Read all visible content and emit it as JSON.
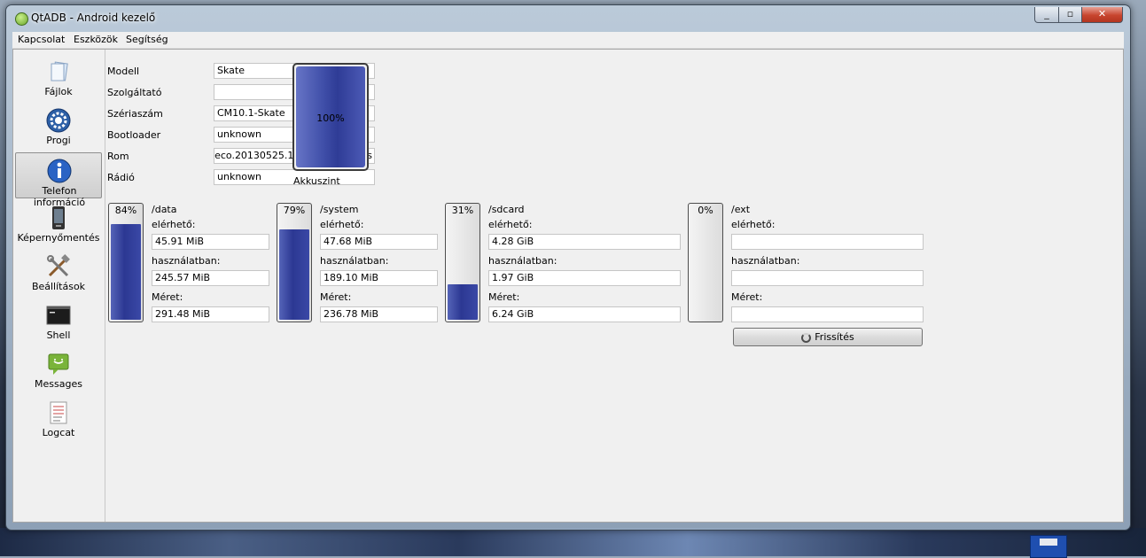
{
  "window": {
    "title": "QtADB - Android kezelő"
  },
  "menu": [
    "Kapcsolat",
    "Eszközök",
    "Segítség"
  ],
  "sidebar": [
    {
      "label": "Fájlok",
      "icon": "files-icon"
    },
    {
      "label": "Progi",
      "icon": "gear-icon"
    },
    {
      "label": "Telefon információ",
      "icon": "info-icon",
      "active": true
    },
    {
      "label": "Képernyőmentés",
      "icon": "phone-icon"
    },
    {
      "label": "Beállítások",
      "icon": "tools-icon"
    },
    {
      "label": "Shell",
      "icon": "terminal-icon"
    },
    {
      "label": "Messages",
      "icon": "message-icon"
    },
    {
      "label": "Logcat",
      "icon": "log-icon"
    }
  ],
  "info": {
    "labels": {
      "model": "Modell",
      "operator": "Szolgáltató",
      "serial": "Szériaszám",
      "bootloader": "Bootloader",
      "rom": "Rom",
      "radio": "Rádió"
    },
    "values": {
      "model": "Skate",
      "operator": "",
      "serial": "CM10.1-Skate",
      "bootloader": "unknown",
      "rom": "g.ceco.20130525.163242 test-keys",
      "radio": "unknown"
    }
  },
  "battery": {
    "percent": 100,
    "percent_text": "100%",
    "label": "Akkuszint"
  },
  "partitions": [
    {
      "name": "/data",
      "percent": 84,
      "percent_text": "84%",
      "available_label": "elérhető:",
      "available": "45.91 MiB",
      "used_label": "használatban:",
      "used": "245.57 MiB",
      "size_label": "Méret:",
      "size": "291.48 MiB"
    },
    {
      "name": "/system",
      "percent": 79,
      "percent_text": "79%",
      "available_label": "elérhető:",
      "available": "47.68 MiB",
      "used_label": "használatban:",
      "used": "189.10 MiB",
      "size_label": "Méret:",
      "size": "236.78 MiB"
    },
    {
      "name": "/sdcard",
      "percent": 31,
      "percent_text": "31%",
      "available_label": "elérhető:",
      "available": "4.28 GiB",
      "used_label": "használatban:",
      "used": "1.97 GiB",
      "size_label": "Méret:",
      "size": "6.24 GiB"
    },
    {
      "name": "/ext",
      "percent": 0,
      "percent_text": "0%",
      "available_label": "elérhető:",
      "available": "",
      "used_label": "használatban:",
      "used": "",
      "size_label": "Méret:",
      "size": ""
    }
  ],
  "refresh_button": {
    "label": "Frissítés"
  },
  "colors": {
    "accent": "#2c3893",
    "window_bg": "#f0f0f0"
  }
}
